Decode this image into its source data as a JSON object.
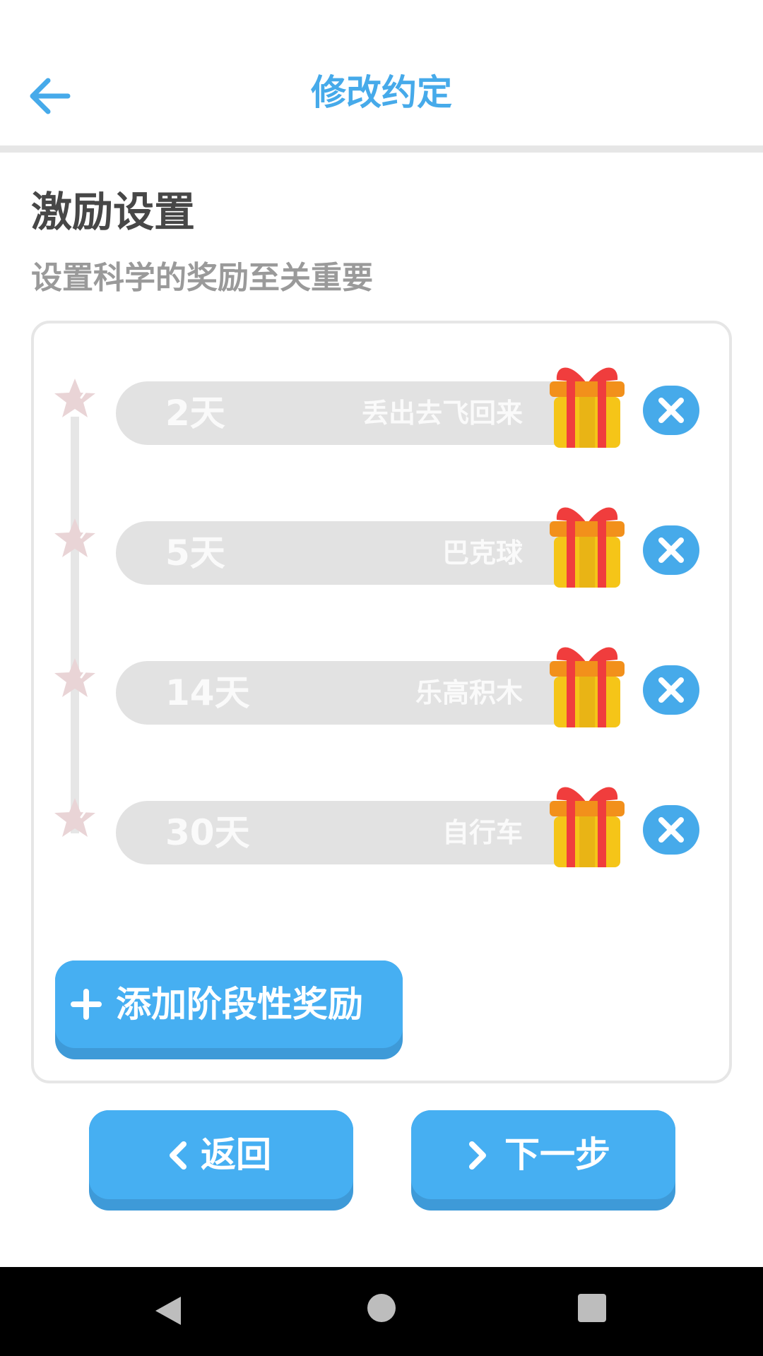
{
  "header": {
    "title": "修改约定",
    "back_icon": "arrow-left-icon"
  },
  "section": {
    "title": "激励设置",
    "subtitle": "设置科学的奖励至关重要"
  },
  "rewards": [
    {
      "days": "2天",
      "name": "丢出去飞回来"
    },
    {
      "days": "5天",
      "name": "巴克球"
    },
    {
      "days": "14天",
      "name": "乐高积木"
    },
    {
      "days": "30天",
      "name": "自行车"
    }
  ],
  "add_reward_label": "添加阶段性奖励",
  "footer": {
    "back_label": "返回",
    "next_label": "下一步"
  },
  "colors": {
    "accent": "#46aaea",
    "button": "#46aff2",
    "pill": "#e2e2e2",
    "gift_box": "#f5c518",
    "gift_ribbon": "#f03d3d"
  }
}
